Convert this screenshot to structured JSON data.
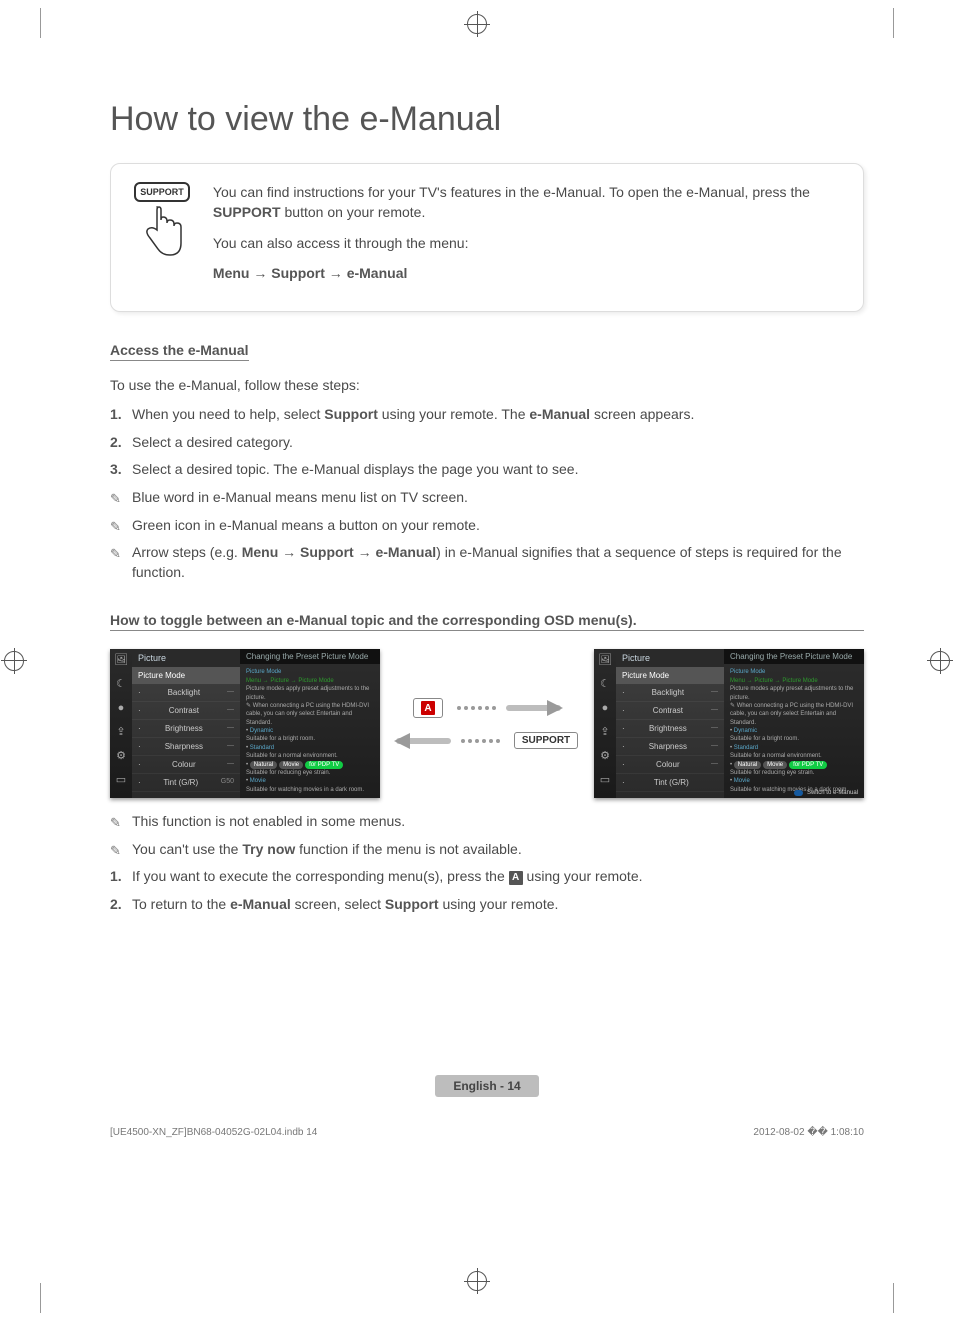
{
  "title": "How to view the e-Manual",
  "intro": {
    "button_label": "SUPPORT",
    "line1_pre": "You can find instructions for your TV's features in the e-Manual. To open the e-Manual, press the ",
    "support_bold": "SUPPORT",
    "line1_post": " button on your remote.",
    "line2": "You can also access it through the menu:",
    "path": "Menu → Support → e-Manual"
  },
  "section_access": {
    "heading": "Access the e-Manual",
    "lead": "To use the e-Manual, follow these steps:",
    "steps": {
      "n1": "1.",
      "s1_pre": "When you need to help, select ",
      "s1_b": "Support",
      "s1_mid": " using your remote. The ",
      "s1_b2": "e-Manual",
      "s1_post": " screen appears.",
      "n2": "2.",
      "s2": "Select a desired category.",
      "n3": "3.",
      "s3": "Select a desired topic. The e-Manual displays the page you want to see."
    },
    "notes": {
      "a": "Blue word in e-Manual means menu list on TV screen.",
      "b": "Green icon in e-Manual means a button on your remote.",
      "c_pre": "Arrow steps (e.g. ",
      "c_path": "Menu → Support → e-Manual",
      "c_post": ") in e-Manual signifies that a sequence of steps is required for the function."
    }
  },
  "section_toggle": {
    "heading": "How to toggle between an e-Manual topic and the corresponding OSD menu(s).",
    "a_key": "A",
    "support_key": "SUPPORT",
    "notes": {
      "a": "This function is not enabled in some menus.",
      "b_pre": "You can't use the ",
      "b_b": "Try now",
      "b_post": " function if the menu is not available."
    },
    "steps": {
      "n1": "1.",
      "s1_pre": "If you want to execute the corresponding menu(s), press the ",
      "s1_key": "A",
      "s1_post": " using your remote.",
      "n2": "2.",
      "s2_pre": "To return to the ",
      "s2_b1": "e-Manual",
      "s2_mid": " screen, select ",
      "s2_b2": "Support",
      "s2_post": " using your remote."
    }
  },
  "osd": {
    "panel_title": "Changing the Preset Picture Mode",
    "menu_head": "Picture",
    "items": {
      "picture_mode": "Picture Mode",
      "backlight": "Backlight",
      "contrast": "Contrast",
      "brightness": "Brightness",
      "sharpness": "Sharpness",
      "colour": "Colour",
      "tint": "Tint (G/R)",
      "tint_val": "G50"
    },
    "detail": {
      "title": "Picture Mode",
      "crumb": "Menu → Picture → Picture Mode",
      "body1": "Picture modes apply preset adjustments to the picture.",
      "body2": "When connecting a PC using the HDMI-DVI cable, you can only select Entertain and Standard.",
      "dynamic": "Dynamic",
      "dynamic_desc": "Suitable for a bright room.",
      "standard": "Standard",
      "standard_desc": "Suitable for a normal environment.",
      "natural": "Natural",
      "natural_desc": "Suitable for reducing eye strain.",
      "movie": "Movie",
      "movie_desc": "Suitable for watching movies in a dark room.",
      "switch": "Switch to e-Manual"
    }
  },
  "footer": {
    "lang": "English - 14",
    "left": "[UE4500-XN_ZF]BN68-04052G-02L04.indb   14",
    "right": "2012-08-02   �� 1:08:10"
  }
}
